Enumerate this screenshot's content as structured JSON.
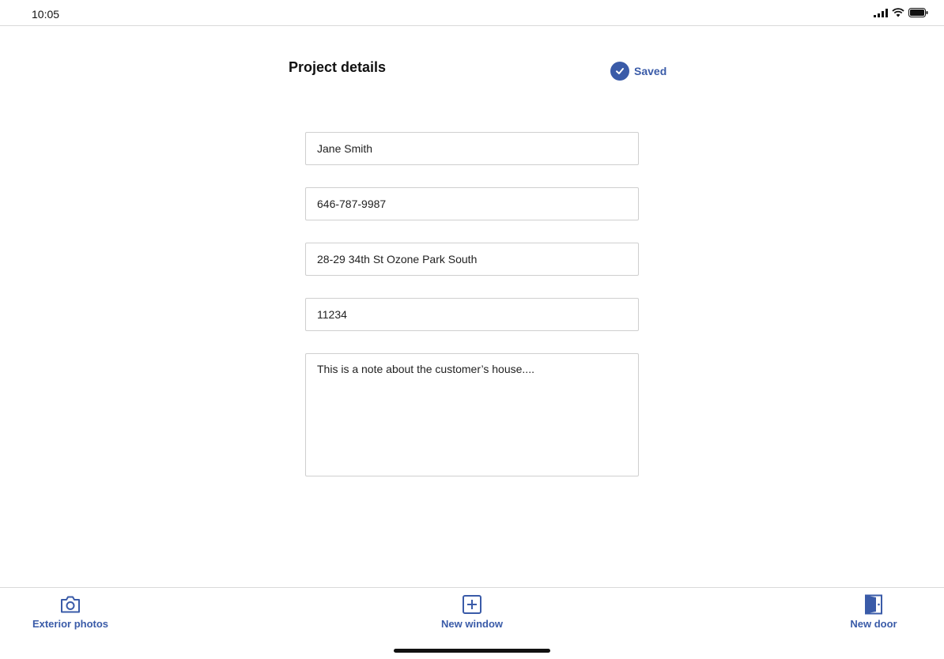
{
  "status_bar": {
    "time": "10:05"
  },
  "header": {
    "title": "Project details",
    "saved_label": "Saved"
  },
  "form": {
    "name": "Jane Smith",
    "phone": "646-787-9987",
    "address": "28-29 34th St Ozone Park South",
    "zip": "11234",
    "notes": "This is a note about the customer’s house...."
  },
  "tabs": [
    {
      "label": "Exterior photos",
      "icon": "camera-icon"
    },
    {
      "label": "New window",
      "icon": "plus-square-icon"
    },
    {
      "label": "New door",
      "icon": "door-icon"
    }
  ],
  "colors": {
    "accent": "#3a5ba8"
  }
}
